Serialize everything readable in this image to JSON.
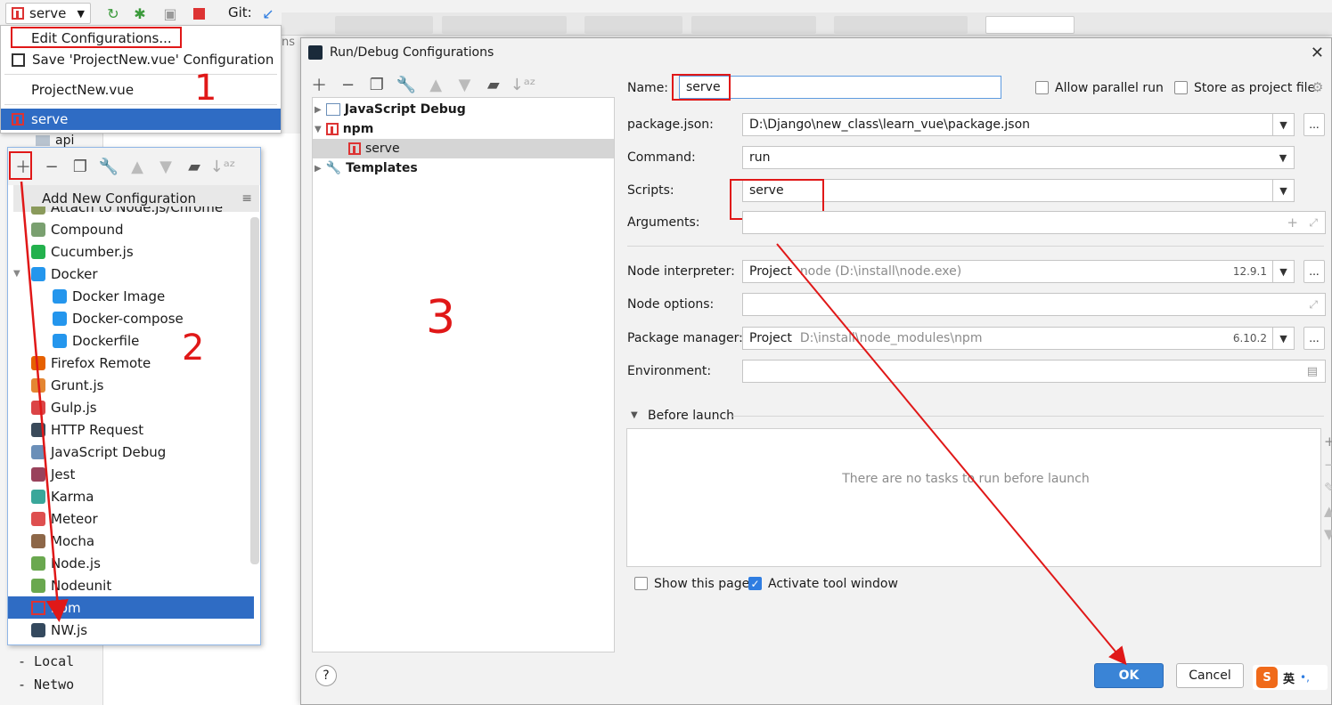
{
  "toolbar": {
    "run_config": "serve",
    "git_label": "Git:"
  },
  "run_menu": {
    "items": [
      {
        "label": "Edit Configurations..."
      },
      {
        "label": "Save 'ProjectNew.vue' Configuration"
      },
      {
        "label": "ProjectNew.vue"
      },
      {
        "label": "serve"
      }
    ]
  },
  "background": {
    "tree_item": "api",
    "tabs_fragment": "ns",
    "terminal": [
      "- Local",
      "- Netwo"
    ]
  },
  "annotations": {
    "step1": "1",
    "step2": "2",
    "step3": "3",
    "color": "#e01818"
  },
  "add_popup": {
    "header": "Add New Configuration",
    "items": [
      {
        "label": "Attach to Node.js/Chrome",
        "icon": "node-attach-icon"
      },
      {
        "label": "Compound",
        "icon": "compound-icon"
      },
      {
        "label": "Cucumber.js",
        "icon": "cucumber-icon"
      },
      {
        "label": "Docker",
        "icon": "docker-icon"
      },
      {
        "label": "Docker Image",
        "icon": "docker-icon"
      },
      {
        "label": "Docker-compose",
        "icon": "docker-icon"
      },
      {
        "label": "Dockerfile",
        "icon": "docker-icon"
      },
      {
        "label": "Firefox Remote",
        "icon": "firefox-icon"
      },
      {
        "label": "Grunt.js",
        "icon": "grunt-icon"
      },
      {
        "label": "Gulp.js",
        "icon": "gulp-icon"
      },
      {
        "label": "HTTP Request",
        "icon": "api-icon"
      },
      {
        "label": "JavaScript Debug",
        "icon": "js-debug-icon"
      },
      {
        "label": "Jest",
        "icon": "jest-icon"
      },
      {
        "label": "Karma",
        "icon": "karma-icon"
      },
      {
        "label": "Meteor",
        "icon": "meteor-icon"
      },
      {
        "label": "Mocha",
        "icon": "mocha-icon"
      },
      {
        "label": "Node.js",
        "icon": "nodejs-icon"
      },
      {
        "label": "Nodeunit",
        "icon": "nodeunit-icon"
      },
      {
        "label": "npm",
        "icon": "npm-icon"
      },
      {
        "label": "NW.js",
        "icon": "nwjs-icon"
      }
    ]
  },
  "dialog": {
    "title": "Run/Debug Configurations",
    "tree": [
      {
        "label": "JavaScript Debug"
      },
      {
        "label": "npm"
      },
      {
        "label": "serve"
      },
      {
        "label": "Templates"
      }
    ],
    "name_label": "Name:",
    "name_value": "serve",
    "allow_parallel": "Allow parallel run",
    "store_project": "Store as project file",
    "package_json_label": "package.json:",
    "package_json_value": "D:\\Django\\new_class\\learn_vue\\package.json",
    "command_label": "Command:",
    "command_value": "run",
    "scripts_label": "Scripts:",
    "scripts_value": "serve",
    "arguments_label": "Arguments:",
    "node_interp_label": "Node interpreter:",
    "node_interp_value": "Project",
    "node_interp_hint": "node (D:\\install\\node.exe)",
    "node_version": "12.9.1",
    "node_options_label": "Node options:",
    "pkg_manager_label": "Package manager:",
    "pkg_manager_value": "Project",
    "pkg_manager_hint": "D:\\install\\node_modules\\npm",
    "pkg_manager_version": "6.10.2",
    "environment_label": "Environment:",
    "before_launch": "Before launch",
    "no_tasks": "There are no tasks to run before launch",
    "show_page": "Show this page",
    "activate_tool": "Activate tool window",
    "ok": "OK",
    "cancel": "Cancel",
    "ime_label": "英"
  }
}
